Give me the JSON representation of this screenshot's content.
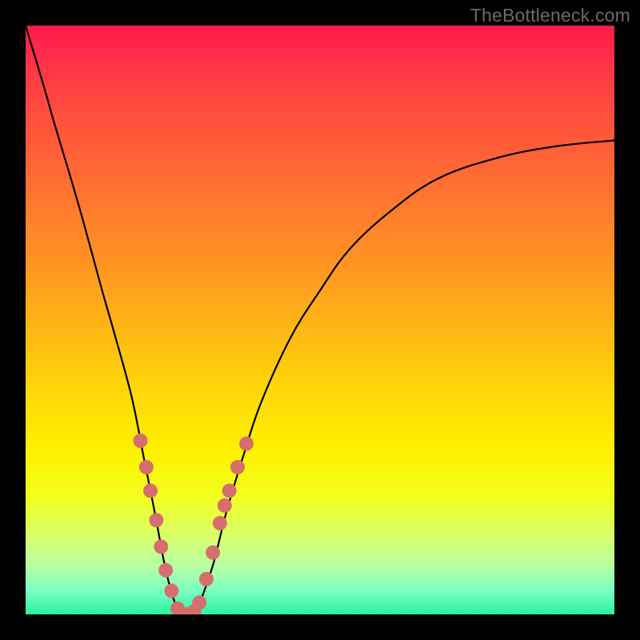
{
  "watermark": "TheBottleneck.com",
  "chart_data": {
    "type": "line",
    "title": "",
    "xlabel": "",
    "ylabel": "",
    "xlim": [
      0,
      100
    ],
    "ylim": [
      0,
      100
    ],
    "grid": false,
    "legend": false,
    "annotations": [],
    "series": [
      {
        "name": "bottleneck-curve",
        "color": "#000000",
        "x": [
          0,
          3,
          5,
          8,
          10,
          13,
          15,
          18,
          20,
          22,
          23.5,
          25,
          26.5,
          28,
          29,
          30,
          32,
          34,
          37,
          40,
          45,
          50,
          55,
          62,
          70,
          80,
          90,
          100
        ],
        "y": [
          100,
          90,
          83,
          73,
          66,
          55,
          48,
          37,
          27,
          17,
          9,
          3,
          0,
          0,
          0,
          3,
          9,
          17,
          27,
          36,
          47,
          55,
          62,
          68.5,
          74,
          77.5,
          79.5,
          80.5
        ]
      }
    ],
    "markers": [
      {
        "name": "curve-highlight-dots",
        "color": "#d76e6e",
        "radius": 9,
        "x": [
          19.5,
          20.5,
          21.2,
          22.2,
          23.0,
          23.8,
          24.8,
          25.8,
          26.8,
          27.6,
          28.6,
          29.5,
          30.7,
          31.8,
          33.0,
          33.8,
          34.6,
          36.0,
          37.5
        ],
        "y": [
          29.5,
          25.0,
          21.0,
          16.0,
          11.5,
          7.5,
          4.0,
          1.0,
          0.0,
          0.0,
          0.5,
          2.0,
          6.0,
          10.5,
          15.5,
          18.5,
          21.0,
          25.0,
          29.0
        ]
      }
    ]
  }
}
